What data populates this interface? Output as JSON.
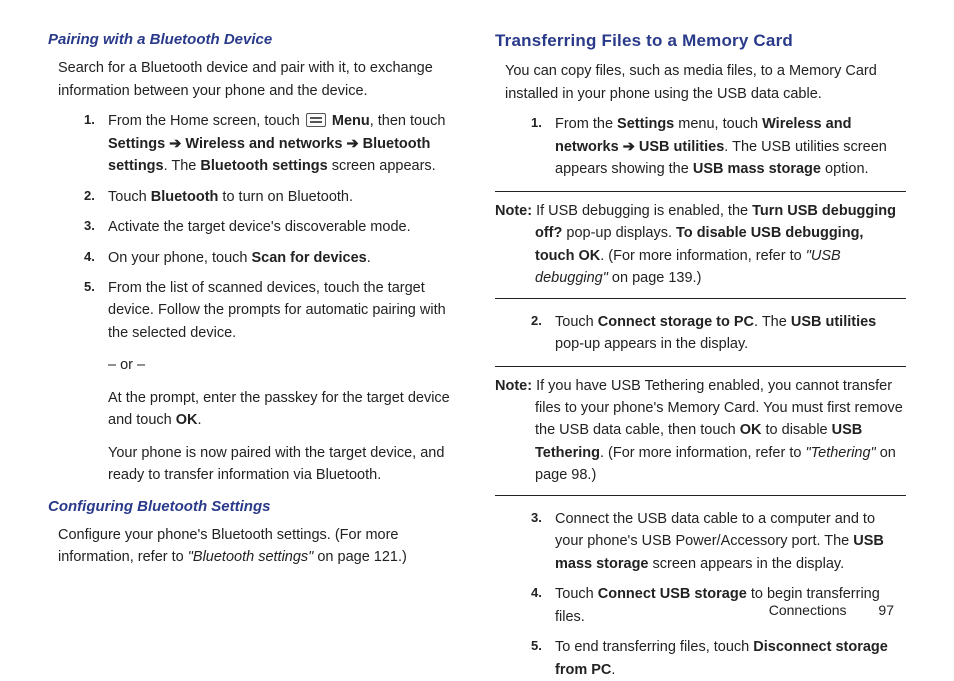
{
  "left": {
    "h3_pairing": "Pairing with a Bluetooth Device",
    "pairing_intro": "Search for a Bluetooth device and pair with it, to exchange information between your phone and the device.",
    "steps": [
      {
        "pre": "From the Home screen, touch ",
        "icon": true,
        "bold1": "Menu",
        "mid1": ", then touch ",
        "bold2": "Settings",
        "arrow1": " ➔ ",
        "bold3": "Wireless and networks",
        "arrow2": " ➔ ",
        "bold4": "Bluetooth settings",
        "mid2": ". The ",
        "bold5": "Bluetooth settings",
        "post": " screen appears."
      },
      {
        "pre": "Touch ",
        "bold1": "Bluetooth",
        "post": " to turn on Bluetooth."
      },
      {
        "text": "Activate the target device's discoverable mode."
      },
      {
        "pre": "On your phone, touch ",
        "bold1": "Scan for devices",
        "post": "."
      },
      {
        "text": "From the list of scanned devices, touch the target device. Follow the prompts for automatic pairing with the selected device.",
        "or": "– or –",
        "sub1_pre": "At the prompt, enter the passkey for the target device and touch ",
        "sub1_bold": "OK",
        "sub1_post": ".",
        "sub2": "Your phone is now paired with the target device, and ready to transfer information via Bluetooth."
      }
    ],
    "h3_config": "Configuring Bluetooth Settings",
    "config_intro_pre": "Configure your phone's Bluetooth settings. (For more information, refer to ",
    "config_intro_ref": "\"Bluetooth settings\"",
    "config_intro_post": "  on page 121.)"
  },
  "right": {
    "h2_transfer": "Transferring Files to a Memory Card",
    "transfer_intro": "You can copy files, such as media files, to a Memory Card installed in your phone using the USB data cable.",
    "step1_pre": "From the ",
    "step1_b1": "Settings",
    "step1_mid1": " menu, touch ",
    "step1_b2": "Wireless and networks",
    "step1_arrow": " ➔ ",
    "step1_b3": "USB utilities",
    "step1_mid2": ". The USB utilities screen appears showing the ",
    "step1_b4": "USB mass storage",
    "step1_post": " option.",
    "note1_label": "Note:",
    "note1_pre": "If USB debugging is enabled, the ",
    "note1_b1": "Turn USB debugging off?",
    "note1_mid1": " pop-up displays. ",
    "note1_b2": "To disable USB debugging, touch OK",
    "note1_mid2": ". (For more information, refer to ",
    "note1_ref": "\"USB debugging\"",
    "note1_post": "  on page 139.)",
    "step2_pre": "Touch ",
    "step2_b1": "Connect storage to PC",
    "step2_mid": ". The ",
    "step2_b2": "USB utilities",
    "step2_post": " pop-up appears in the display.",
    "note2_label": "Note:",
    "note2_pre": "If you have USB Tethering enabled, you cannot transfer files to your phone's Memory Card. You must first remove the USB data cable, then touch ",
    "note2_b1": "OK",
    "note2_mid1": " to disable ",
    "note2_b2": "USB Tethering",
    "note2_mid2": ". (For more information, refer to ",
    "note2_ref": "\"Tethering\"",
    "note2_post": "  on page 98.)",
    "step3_pre": "Connect the USB data cable to a computer and to your phone's USB Power/Accessory port. The ",
    "step3_b1": "USB mass storage",
    "step3_post": " screen appears in the display.",
    "step4_pre": "Touch ",
    "step4_b1": "Connect USB storage",
    "step4_post": " to begin transferring files.",
    "step5_pre": "To end transferring files, touch ",
    "step5_b1": "Disconnect storage from PC",
    "step5_post": "."
  },
  "footer": {
    "section": "Connections",
    "page": "97"
  }
}
